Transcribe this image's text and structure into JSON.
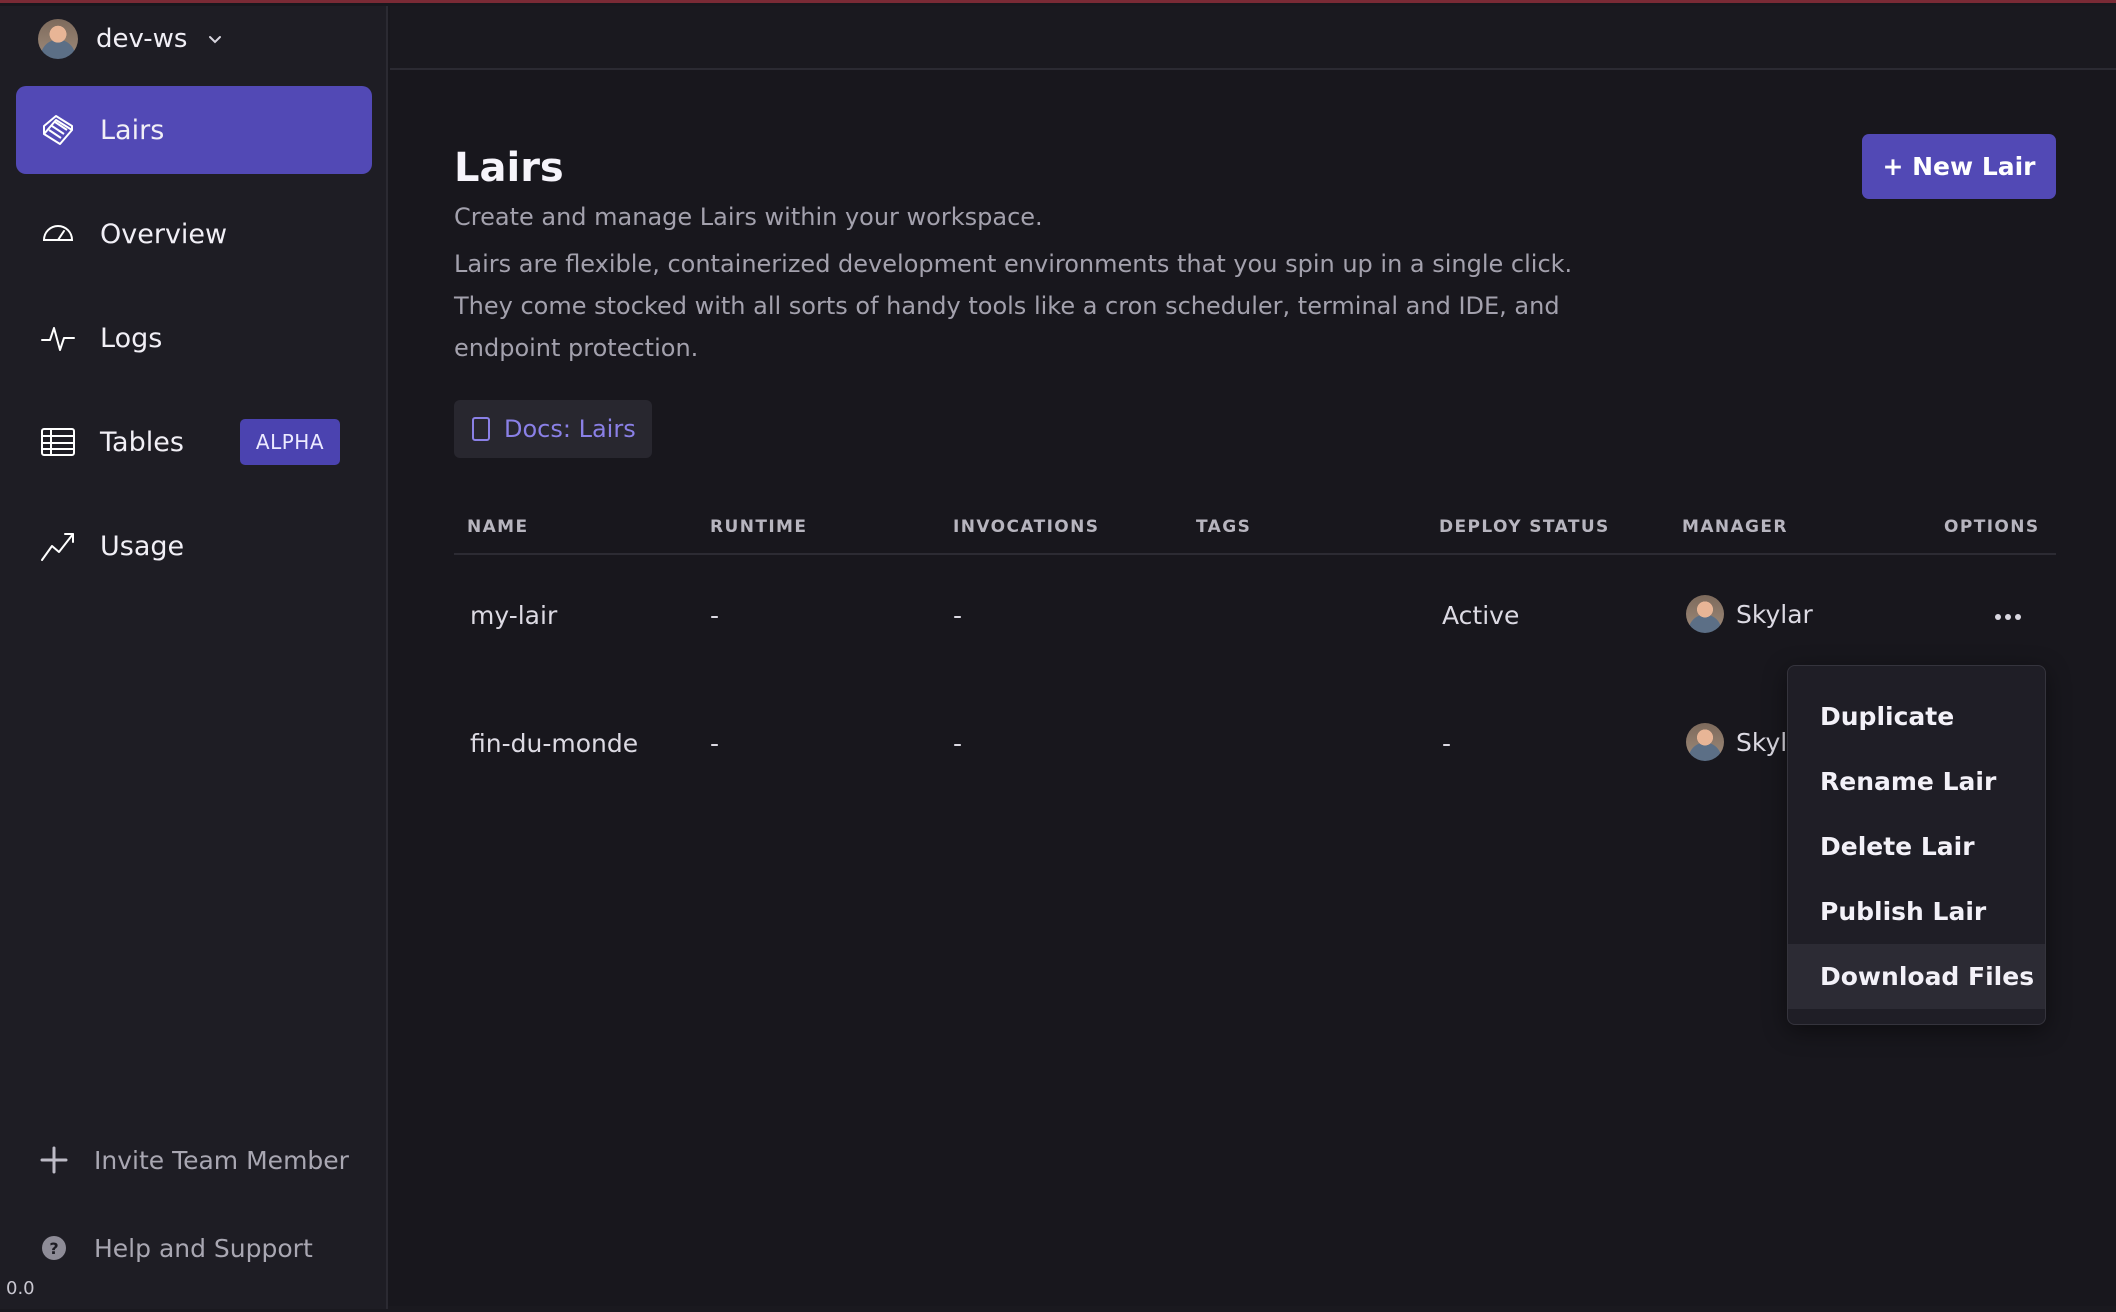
{
  "workspace": {
    "name": "dev-ws"
  },
  "sidebar": {
    "items": [
      {
        "label": "Lairs",
        "icon": "lairs-icon",
        "active": true
      },
      {
        "label": "Overview",
        "icon": "gauge-icon"
      },
      {
        "label": "Logs",
        "icon": "pulse-icon"
      },
      {
        "label": "Tables",
        "icon": "table-icon",
        "badge": "ALPHA"
      },
      {
        "label": "Usage",
        "icon": "trending-up-icon"
      }
    ],
    "invite_label": "Invite Team Member",
    "help_label": "Help and Support",
    "version": "0.0"
  },
  "page": {
    "title": "Lairs",
    "subtitle": "Create and manage Lairs within your workspace.",
    "description": "Lairs are flexible, containerized development environments that you spin up in a single click. They come stocked with all sorts of handy tools like a cron scheduler, terminal and IDE, and endpoint protection.",
    "new_button": "+ New Lair",
    "docs_link": "Docs: Lairs"
  },
  "table": {
    "columns": [
      "NAME",
      "RUNTIME",
      "INVOCATIONS",
      "TAGS",
      "DEPLOY STATUS",
      "MANAGER",
      "OPTIONS"
    ],
    "rows": [
      {
        "name": "my-lair",
        "runtime": "-",
        "invocations": "-",
        "tags": "",
        "deploy_status": "Active",
        "manager": "Skylar"
      },
      {
        "name": "fin-du-monde",
        "runtime": "-",
        "invocations": "-",
        "tags": "",
        "deploy_status": "-",
        "manager": "Skyla"
      }
    ]
  },
  "options_menu": {
    "items": [
      "Duplicate",
      "Rename Lair",
      "Delete Lair",
      "Publish Lair",
      "Download Files"
    ],
    "highlighted": "Download Files"
  },
  "colors": {
    "accent": "#5249b5",
    "background": "#18171d",
    "sidebar": "#1e1d24",
    "link": "#8a80e6"
  }
}
